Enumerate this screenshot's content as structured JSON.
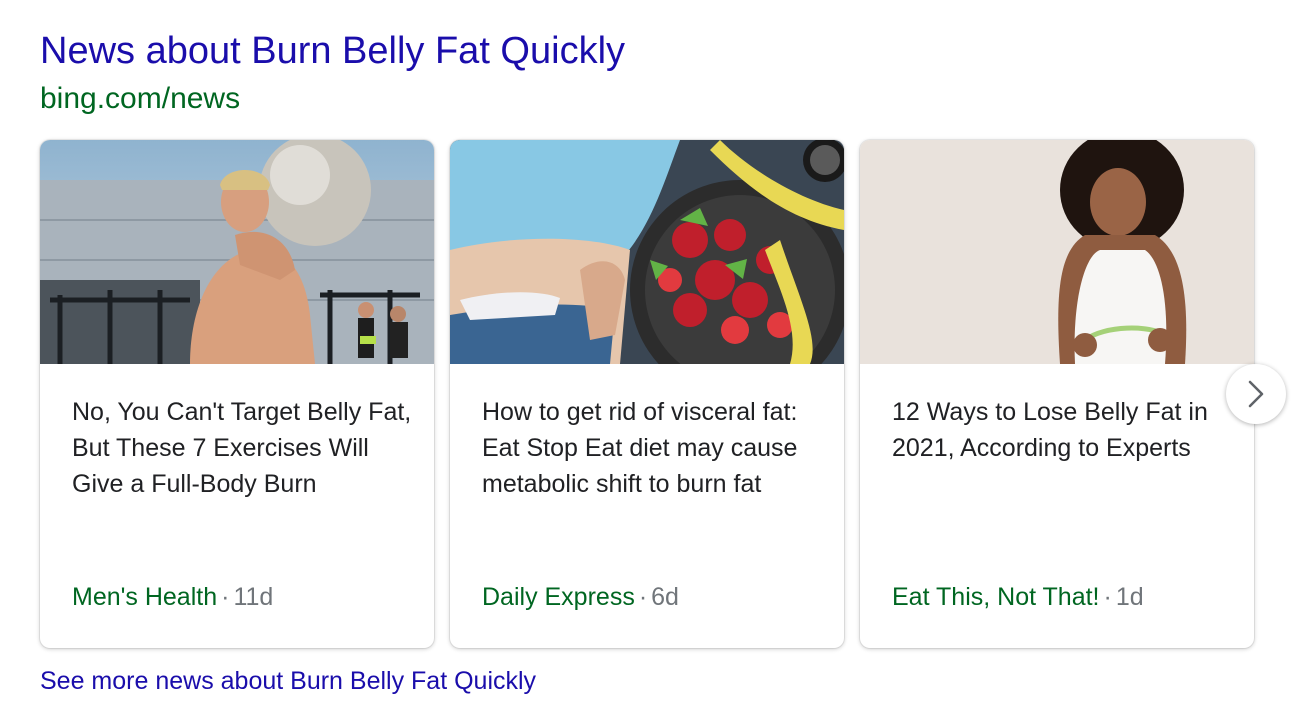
{
  "header": {
    "title": "News about Burn Belly Fat Quickly",
    "source_url": "bing.com/news"
  },
  "cards": [
    {
      "image_icon": "man-lifting-stone-image",
      "headline": "No, You Can't Target Belly Fat, But These 7 Exercises Will Give a Full-Body Burn",
      "publisher": "Men's Health",
      "separator": "·",
      "age": "11d"
    },
    {
      "image_icon": "belly-and-fruit-bowl-image",
      "headline": "How to get rid of visceral fat: Eat Stop Eat diet may cause metabolic shift to burn fat",
      "publisher": "Daily Express",
      "separator": "·",
      "age": "6d"
    },
    {
      "image_icon": "woman-measuring-waist-image",
      "headline": "12 Ways to Lose Belly Fat in 2021, According to Experts",
      "publisher": "Eat This, Not That!",
      "separator": "·",
      "age": "1d"
    }
  ],
  "carousel": {
    "next_icon": "chevron-right-icon"
  },
  "footer": {
    "see_more": "See more news about Burn Belly Fat Quickly"
  },
  "colors": {
    "link": "#1a0dab",
    "source_green": "#006621",
    "text": "#202124",
    "muted": "#70757a"
  }
}
